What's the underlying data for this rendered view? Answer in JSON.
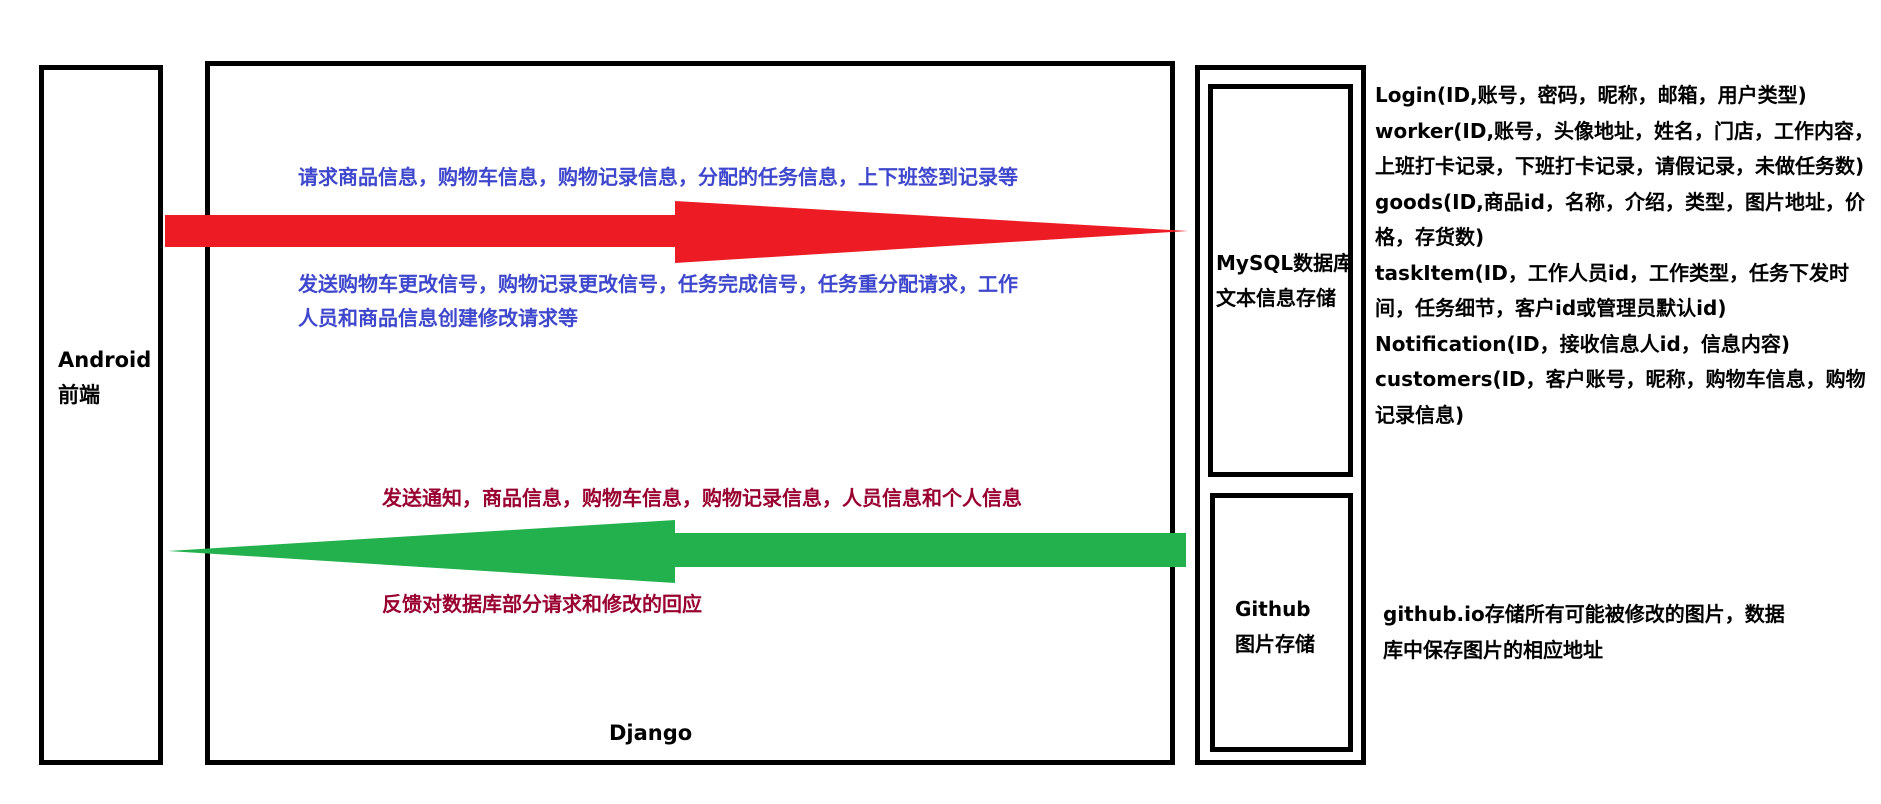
{
  "android": {
    "line1": "Android",
    "line2": "前端"
  },
  "django": {
    "label": "Django"
  },
  "mysql": {
    "line1": "MySQL数据库",
    "line2": "文本信息存储"
  },
  "github": {
    "line1": "Github",
    "line2": "图片存储"
  },
  "request_arrow": {
    "color": "#ed1c24",
    "label_top": "请求商品信息，购物车信息，购物记录信息，分配的任务信息，上下班签到记录等",
    "label_bottom_1": "发送购物车更改信号，购物记录更改信号，任务完成信号，任务重分配请求，工作",
    "label_bottom_2": "人员和商品信息创建修改请求等"
  },
  "response_arrow": {
    "color": "#22b14c",
    "label_top": "发送通知，商品信息，购物车信息，购物记录信息，人员信息和个人信息",
    "label_bottom": "反馈对数据库部分请求和修改的回应"
  },
  "schema": [
    "Login(ID,账号，密码，昵称，邮箱，用户类型)",
    "worker(ID,账号，头像地址，姓名，门店，工作内容，",
    "上班打卡记录，下班打卡记录，请假记录，未做任务数)",
    "goods(ID,商品id，名称，介绍，类型，图片地址，价",
    "格，存货数)",
    "taskItem(ID，工作人员id，工作类型，任务下发时",
    "间，任务细节，客户id或管理员默认id)",
    "Notification(ID，接收信息人id，信息内容)",
    "customers(ID，客户账号，昵称，购物车信息，购物",
    "记录信息)"
  ],
  "github_desc": [
    "github.io存储所有可能被修改的图片，数据",
    "库中保存图片的相应地址"
  ]
}
